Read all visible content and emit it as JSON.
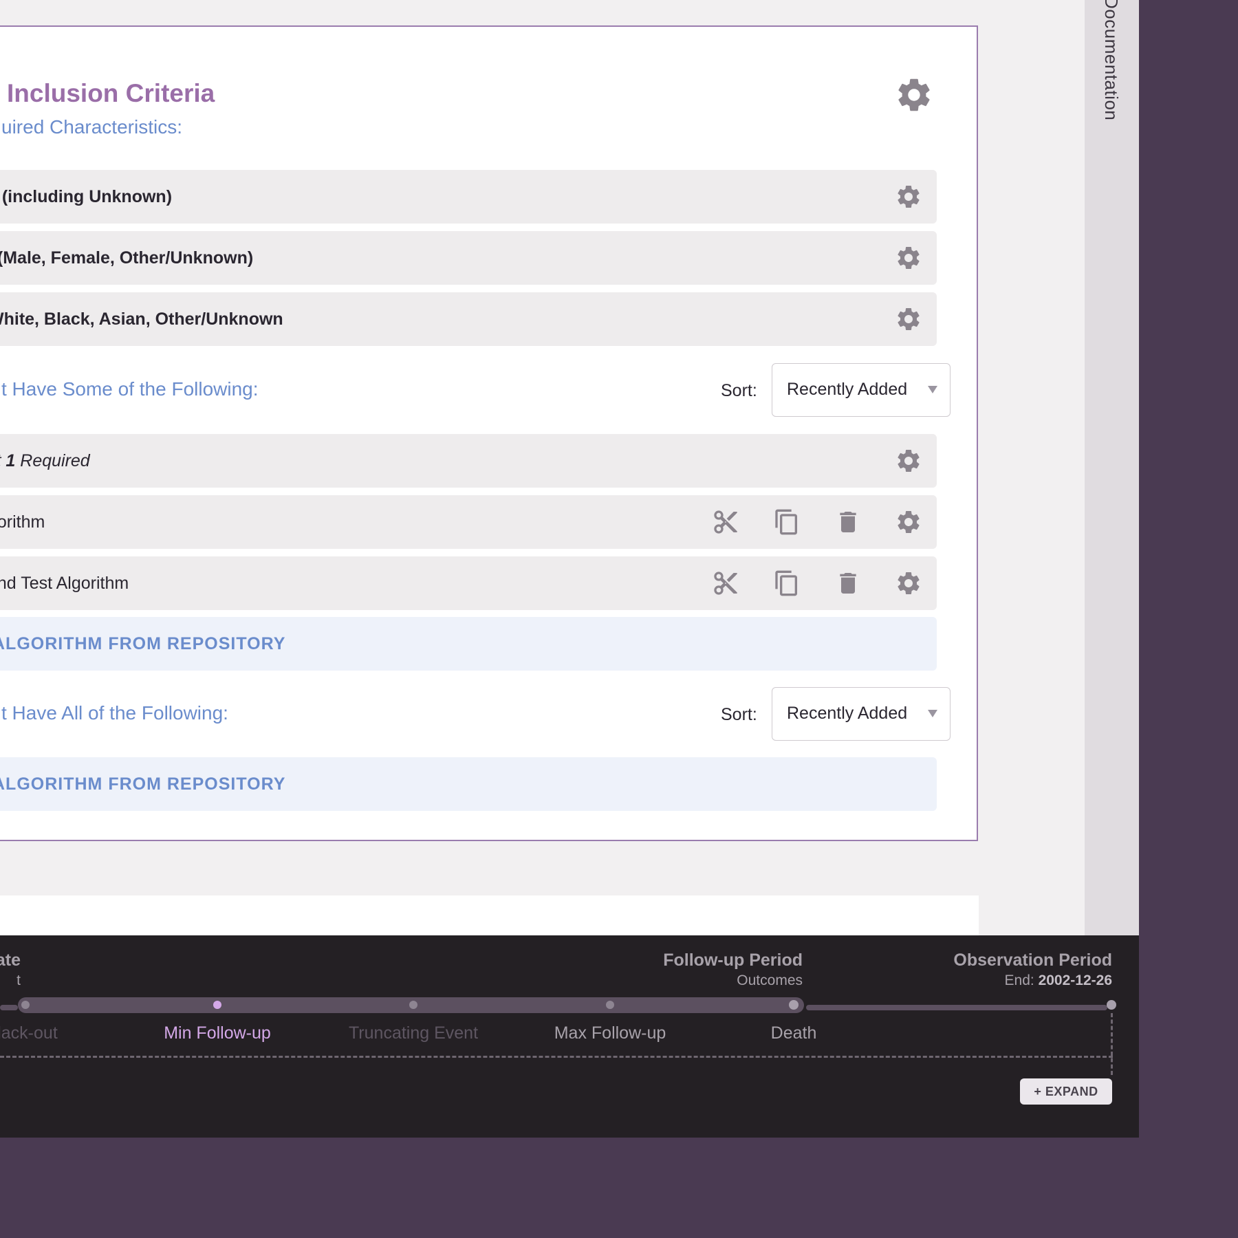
{
  "sidebar": {
    "documentation_label": "Documentation"
  },
  "card": {
    "title": "Inclusion Criteria",
    "required_section_label": "uired Characteristics:",
    "characteristics": [
      {
        "text": "ll (including Unknown)"
      },
      {
        "text": "l (Male, Female, Other/Unknown)"
      },
      {
        "text": "White, Black, Asian, Other/Unknown"
      }
    ],
    "some_section": {
      "label": "t Have Some of the Following:",
      "sort_label": "Sort:",
      "sort_value": "Recently Added",
      "requirement_prefix": "st ",
      "requirement_count": "1",
      "requirement_suffix": " Required",
      "algorithms": [
        {
          "name": "gorithm"
        },
        {
          "name": "ond Test Algorithm"
        }
      ],
      "add_label": "ALGORITHM FROM REPOSITORY"
    },
    "all_section": {
      "label": "t Have All of the Following:",
      "sort_label": "Sort:",
      "sort_value": "Recently Added",
      "add_label": "ALGORITHM FROM REPOSITORY"
    }
  },
  "timeline": {
    "index_header": {
      "title": "ate",
      "subtitle": "t"
    },
    "followup_header": {
      "title": "Follow-up Period",
      "subtitle": "Outcomes"
    },
    "observation_header": {
      "title": "Observation Period",
      "end_label": "End: ",
      "end_date": "2002-12-26"
    },
    "events": [
      {
        "label": "lack-out",
        "state": "dim"
      },
      {
        "label": "Min Follow-up",
        "state": "active"
      },
      {
        "label": "Truncating Event",
        "state": "dim"
      },
      {
        "label": "Max Follow-up",
        "state": "normal"
      },
      {
        "label": "Death",
        "state": "normal"
      }
    ],
    "expand_label": "+ EXPAND"
  },
  "colors": {
    "title_purple": "#9a6ea8",
    "section_blue": "#6a8ccc",
    "active_event": "#d4a8e8",
    "footer_bg": "#242024",
    "outer_bg": "#4a3a52"
  }
}
